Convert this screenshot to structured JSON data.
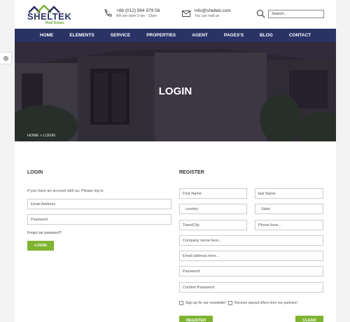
{
  "brand": {
    "name": "SHELTEK",
    "tagline": "Real Estate"
  },
  "contact": {
    "phone": "+88 (012) 564 979 56",
    "hours": "We are open 9 am - 10pm",
    "email": "info@sheltek.com",
    "email_note": "You can mail us"
  },
  "search": {
    "placeholder": "Search..."
  },
  "nav": [
    "HOME",
    "ELEMENTS",
    "SERVICE",
    "PROPERTIES",
    "AGENT",
    "PAGES'S",
    "BLOG",
    "CONTACT"
  ],
  "hero": {
    "title": "LOGIN",
    "breadcrumb": "HOME  >  LOGIN"
  },
  "login": {
    "title": "LOGIN",
    "intro": "If you have an account with us, Please log in.",
    "email_placeholder": "Email Address",
    "password_placeholder": "Password",
    "forgot": "Forgot our password?",
    "button": "LOGIN"
  },
  "register": {
    "title": "REGISTER",
    "first_name": "First Name",
    "last_name": "last Name",
    "country": "country",
    "state": "State",
    "town": "Town/City",
    "phone": "Phone here...",
    "company": "Company neme here...",
    "email": "Email address here...",
    "password": "Password",
    "confirm": "Confirm Password",
    "newsletter": "Sign up for our newsletter!",
    "offers": "Receive special offers from our partners!",
    "register_button": "REGISTER",
    "clear_button": "CLEAR"
  },
  "colors": {
    "brand_navy": "#2b3266",
    "accent_green": "#7fb331"
  }
}
